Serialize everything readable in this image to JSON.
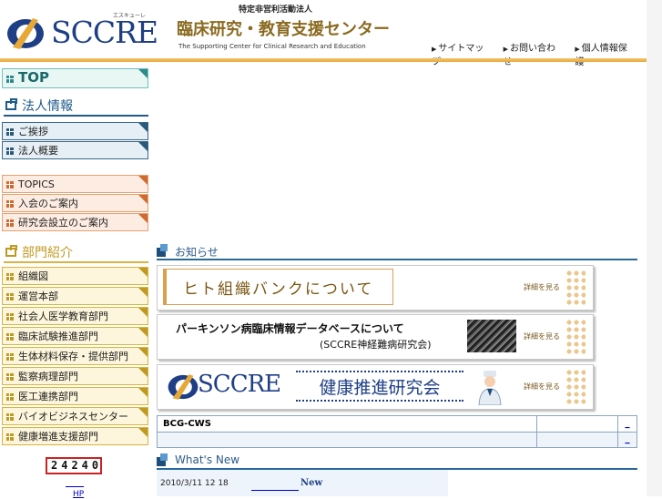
{
  "header": {
    "logo_text": "SCCRE",
    "logo_ruby": "エスキューレ",
    "org_type": "特定非営利活動法人",
    "org_name": "臨床研究・教育支援センター",
    "org_name_en": "The Supporting Center for Clinical Research and Education",
    "links": [
      "サイトマップ",
      "お問い合わせ",
      "個人情報保護"
    ]
  },
  "sidebar": {
    "top": "TOP",
    "corp_heading": "法人情報",
    "corp_items": [
      "ご挨拶",
      "法人概要"
    ],
    "topics_items": [
      "TOPICS",
      "入会のご案内",
      "研究会設立のご案内"
    ],
    "dept_heading": "部門紹介",
    "dept_items": [
      "組織図",
      "運営本部",
      "社会人医学教育部門",
      "臨床試験推進部門",
      "生体材料保存・提供部門",
      "監察病理部門",
      "医工連携部門",
      "バイオビジネスセンター",
      "健康増進支援部門"
    ],
    "counter": "24240",
    "hp_label": "HP"
  },
  "main": {
    "notice_heading": "お知らせ",
    "banners": [
      {
        "title": "ヒト組織バンクについて",
        "more": "詳細を見る"
      },
      {
        "title": "パーキンソン病臨床情報データベースについて",
        "subtitle": "(SCCRE神経難病研究会)",
        "more": "詳細を見る"
      },
      {
        "logo": "SCCRE",
        "title": "健康推進研究会",
        "more": "詳細を見る"
      }
    ],
    "table_rows": [
      {
        "name": "BCG-CWS",
        "link": "_"
      },
      {
        "name": "",
        "link": "_"
      }
    ],
    "whats_new_heading": "What's New",
    "news": [
      {
        "date": "2010/3/11 12 18",
        "label": "New"
      }
    ]
  },
  "colors": {
    "brand_blue": "#1e3f86",
    "gold": "#c09a20",
    "teal": "#2e8b8b",
    "orange": "#d06a30"
  }
}
